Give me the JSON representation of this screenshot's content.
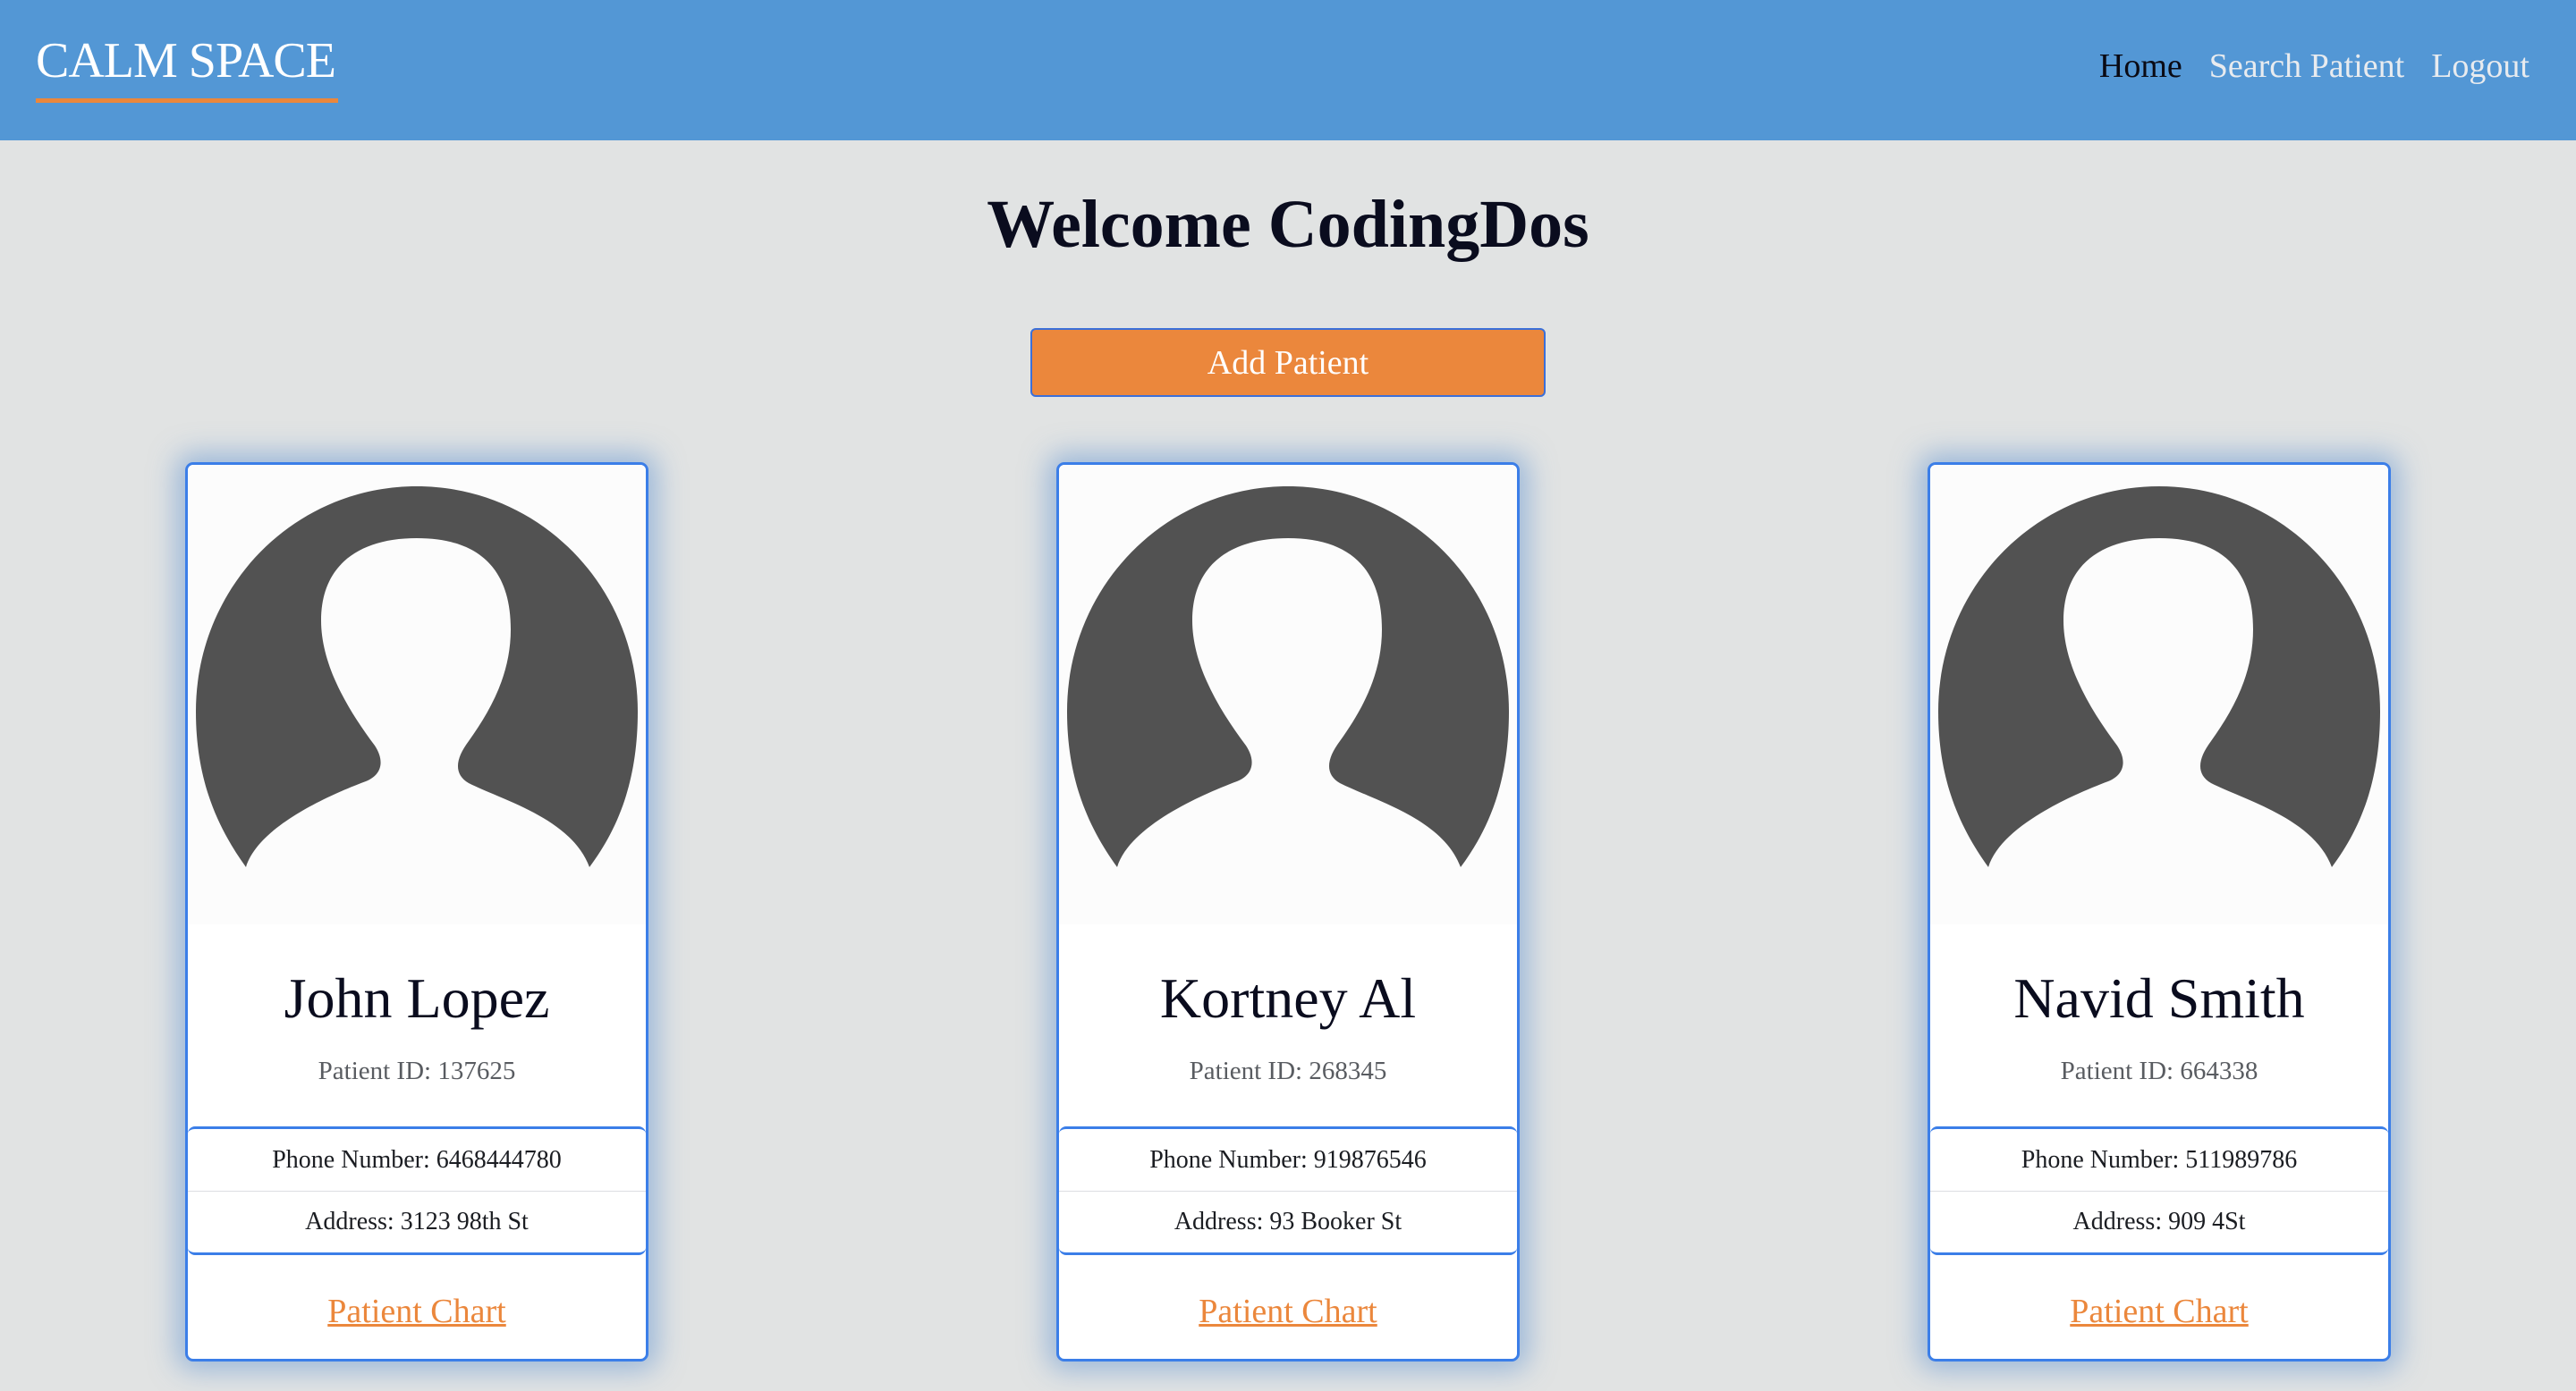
{
  "navbar": {
    "brand": "CALM SPACE",
    "links": [
      {
        "label": "Home",
        "active": true
      },
      {
        "label": "Search Patient",
        "active": false
      },
      {
        "label": "Logout",
        "active": false
      }
    ]
  },
  "main": {
    "welcome": "Welcome CodingDos",
    "add_patient_label": "Add Patient"
  },
  "patients": [
    {
      "name": "John Lopez",
      "patient_id": "Patient ID: 137625",
      "phone": "Phone Number: 6468444780",
      "address": "Address: 3123 98th St",
      "chart_link": "Patient Chart",
      "avatar_icon": "user-silhouette-icon"
    },
    {
      "name": "Kortney Al",
      "patient_id": "Patient ID: 268345",
      "phone": "Phone Number: 919876546",
      "address": "Address: 93 Booker St",
      "chart_link": "Patient Chart",
      "avatar_icon": "user-silhouette-icon"
    },
    {
      "name": "Navid Smith",
      "patient_id": "Patient ID: 664338",
      "phone": "Phone Number: 511989786",
      "address": "Address: 909 4St",
      "chart_link": "Patient Chart",
      "avatar_icon": "user-silhouette-icon"
    }
  ],
  "colors": {
    "navbar_bg": "#5397d5",
    "accent_orange": "#eb873c",
    "card_border": "#3b7ee8",
    "page_bg": "#e1e3e3",
    "avatar_fill": "#525252"
  }
}
